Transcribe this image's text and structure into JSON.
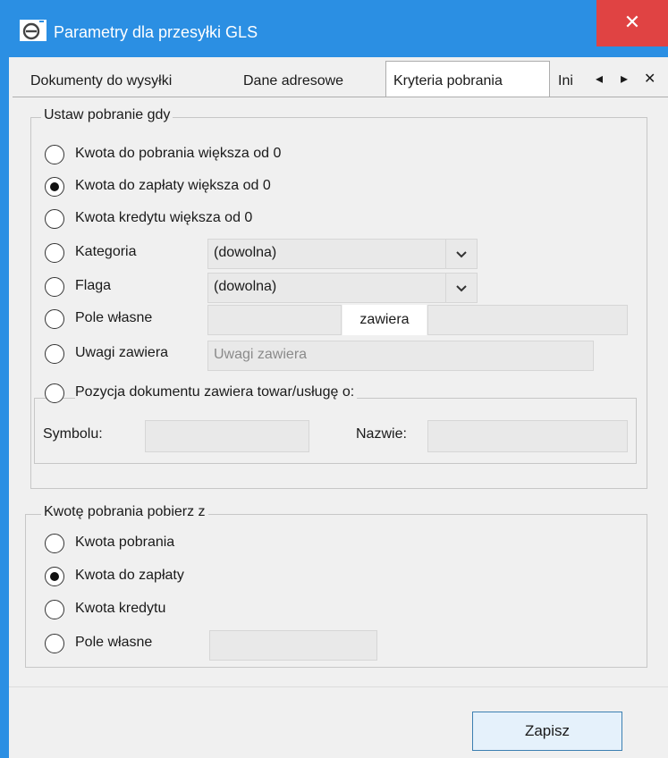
{
  "window": {
    "title": "Parametry dla przesyłki GLS",
    "close_glyph": "✕"
  },
  "tabs": [
    {
      "label": "Dokumenty do wysyłki"
    },
    {
      "label": "Dane adresowe"
    },
    {
      "label": "Kryteria pobrania"
    },
    {
      "label": "Ini"
    }
  ],
  "tab_nav": {
    "prev": "◂",
    "next": "▸",
    "close": "✕"
  },
  "group1": {
    "title": "Ustaw pobranie gdy",
    "options": [
      {
        "label": "Kwota do pobrania większa od 0",
        "selected": false
      },
      {
        "label": "Kwota do zapłaty większa od 0",
        "selected": true
      },
      {
        "label": "Kwota kredytu większa od 0",
        "selected": false
      },
      {
        "label": "Kategoria",
        "selected": false
      },
      {
        "label": "Flaga",
        "selected": false
      },
      {
        "label": "Pole własne",
        "selected": false
      },
      {
        "label": "Uwagi zawiera",
        "selected": false
      }
    ],
    "kategoria_value": "(dowolna)",
    "flaga_value": "(dowolna)",
    "pole_wlasne_value": "",
    "zawiera_label": "zawiera",
    "zawiera_value": "",
    "uwagi_placeholder": "Uwagi zawiera",
    "pozycja": {
      "label": "Pozycja dokumentu zawiera towar/usługę o:",
      "selected": false,
      "symbol_label": "Symbolu:",
      "symbol_value": "",
      "nazwa_label": "Nazwie:",
      "nazwa_value": ""
    }
  },
  "group2": {
    "title": "Kwotę pobrania pobierz z",
    "options": [
      {
        "label": "Kwota pobrania",
        "selected": false
      },
      {
        "label": "Kwota do zapłaty",
        "selected": true
      },
      {
        "label": "Kwota kredytu",
        "selected": false
      },
      {
        "label": "Pole własne",
        "selected": false
      }
    ],
    "pole_wlasne_value": ""
  },
  "footer": {
    "save_label": "Zapisz"
  },
  "colors": {
    "titlebar": "#2b8fe3",
    "close": "#e04343",
    "accent_button": "#e5f1fb"
  }
}
